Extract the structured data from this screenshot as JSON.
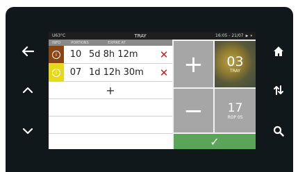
{
  "status_bar": {
    "temperature": "U63°C",
    "title": "TRAY",
    "datetime": "16:05 - 21/07"
  },
  "columns": {
    "info": "INFO",
    "portions": "PORTIONS",
    "expire": "EXPIRE AT"
  },
  "rows": [
    {
      "portions": "10",
      "expire": "5d 8h 12m",
      "delete": "✕",
      "badge_color": "#8b4513"
    },
    {
      "portions": "07",
      "expire": "1d 12h 30m",
      "delete": "✕",
      "badge_color": "#e8d81a"
    }
  ],
  "add_label": "+",
  "tray": {
    "number": "03",
    "label": "TRAY"
  },
  "rop": {
    "number": "17",
    "label": "ROP 05"
  },
  "plus_label": "+",
  "minus_label": "−",
  "confirm_label": "✓",
  "colors": {
    "bezel": "#10181c",
    "confirm": "#5ba55b",
    "tile": "#a6a6a6",
    "delete": "#d11c1c"
  },
  "side_buttons": {
    "left": [
      "back-arrow-icon",
      "chevron-up-icon",
      "chevron-down-icon"
    ],
    "right": [
      "home-icon",
      "swap-arrows-icon",
      "search-icon"
    ]
  }
}
